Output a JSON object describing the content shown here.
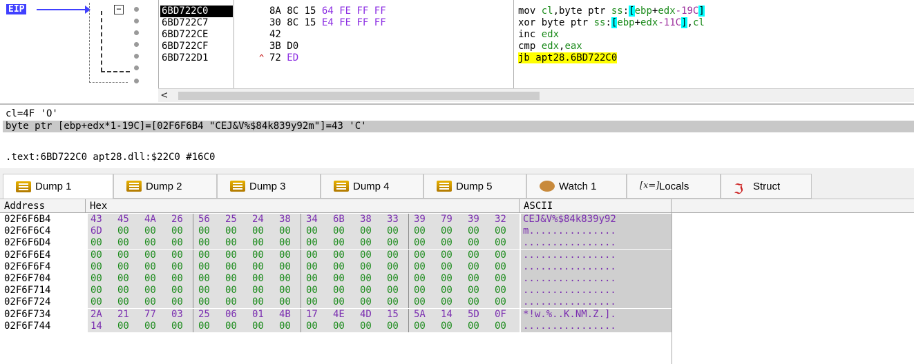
{
  "disassembly": {
    "eip_label": "EIP",
    "collapse_glyph": "−",
    "scroll_left_glyph": "<",
    "rows": [
      {
        "address": "6BD722C0",
        "marker": "",
        "bytes": [
          {
            "t": "8A",
            "c": "a"
          },
          {
            "t": "8C",
            "c": "a"
          },
          {
            "t": "15",
            "c": "a"
          },
          {
            "t": "64",
            "c": "b"
          },
          {
            "t": "FE",
            "c": "b"
          },
          {
            "t": "FF",
            "c": "b"
          },
          {
            "t": "FF",
            "c": "b"
          }
        ],
        "selected": true,
        "instr": [
          {
            "t": "mov ",
            "c": "kw"
          },
          {
            "t": "cl",
            "c": "reg"
          },
          {
            "t": ",byte ptr ",
            "c": "kw"
          },
          {
            "t": "ss",
            "c": "reg"
          },
          {
            "t": ":",
            "c": "kw"
          },
          {
            "t": "[",
            "c": "bracket"
          },
          {
            "t": "ebp",
            "c": "reg"
          },
          {
            "t": "+",
            "c": "kw"
          },
          {
            "t": "edx",
            "c": "reg"
          },
          {
            "t": "-19C",
            "c": "num"
          },
          {
            "t": "]",
            "c": "bracket"
          }
        ]
      },
      {
        "address": "6BD722C7",
        "marker": "",
        "bytes": [
          {
            "t": "30",
            "c": "a"
          },
          {
            "t": "8C",
            "c": "a"
          },
          {
            "t": "15",
            "c": "a"
          },
          {
            "t": "E4",
            "c": "b"
          },
          {
            "t": "FE",
            "c": "b"
          },
          {
            "t": "FF",
            "c": "b"
          },
          {
            "t": "FF",
            "c": "b"
          }
        ],
        "selected": false,
        "instr": [
          {
            "t": "xor ",
            "c": "kw"
          },
          {
            "t": "byte ptr ",
            "c": "kw"
          },
          {
            "t": "ss",
            "c": "reg"
          },
          {
            "t": ":",
            "c": "kw"
          },
          {
            "t": "[",
            "c": "bracket"
          },
          {
            "t": "ebp",
            "c": "reg"
          },
          {
            "t": "+",
            "c": "kw"
          },
          {
            "t": "edx",
            "c": "reg"
          },
          {
            "t": "-11C",
            "c": "num"
          },
          {
            "t": "]",
            "c": "bracket"
          },
          {
            "t": ",",
            "c": "kw"
          },
          {
            "t": "cl",
            "c": "reg"
          }
        ]
      },
      {
        "address": "6BD722CE",
        "marker": "",
        "bytes": [
          {
            "t": "42",
            "c": "a"
          }
        ],
        "selected": false,
        "instr": [
          {
            "t": "inc ",
            "c": "kw"
          },
          {
            "t": "edx",
            "c": "reg"
          }
        ]
      },
      {
        "address": "6BD722CF",
        "marker": "",
        "bytes": [
          {
            "t": "3B",
            "c": "a"
          },
          {
            "t": "D0",
            "c": "a"
          }
        ],
        "selected": false,
        "instr": [
          {
            "t": "cmp ",
            "c": "kw"
          },
          {
            "t": "edx",
            "c": "reg"
          },
          {
            "t": ",",
            "c": "kw"
          },
          {
            "t": "eax",
            "c": "reg"
          }
        ]
      },
      {
        "address": "6BD722D1",
        "marker": "^",
        "bytes": [
          {
            "t": "72",
            "c": "a"
          },
          {
            "t": "ED",
            "c": "b"
          }
        ],
        "selected": false,
        "instr": [
          {
            "t": "jb",
            "c": "hl"
          },
          {
            "t": " apt28.6BD722C0",
            "c": "hl"
          }
        ]
      }
    ]
  },
  "info": {
    "line1": "cl=4F 'O'",
    "line2": "byte ptr [ebp+edx*1-19C]=[02F6F6B4 \"CEJ&V%$84k839y92m\"]=43 'C'",
    "line3": ".text:6BD722C0 apt28.dll:$22C0 #16C0"
  },
  "tabs": [
    {
      "label": "Dump 1",
      "icon": "dump-icon",
      "active": true
    },
    {
      "label": "Dump 2",
      "icon": "dump-icon",
      "active": false
    },
    {
      "label": "Dump 3",
      "icon": "dump-icon",
      "active": false
    },
    {
      "label": "Dump 4",
      "icon": "dump-icon",
      "active": false
    },
    {
      "label": "Dump 5",
      "icon": "dump-icon",
      "active": false
    },
    {
      "label": "Watch 1",
      "icon": "watch-icon",
      "active": false
    },
    {
      "label": "Locals",
      "icon": "locals-icon",
      "icon_text": "[x=]",
      "active": false
    },
    {
      "label": "Struct",
      "icon": "struct-icon",
      "icon_text": "ℑ",
      "active": false
    }
  ],
  "dump": {
    "headers": {
      "address": "Address",
      "hex": "Hex",
      "ascii": "ASCII"
    },
    "rows": [
      {
        "address": "02F6F6B4",
        "bytes": [
          "43",
          "45",
          "4A",
          "26",
          "56",
          "25",
          "24",
          "38",
          "34",
          "6B",
          "38",
          "33",
          "39",
          "79",
          "39",
          "32"
        ],
        "ascii": "CEJ&V%$84k839y92"
      },
      {
        "address": "02F6F6C4",
        "bytes": [
          "6D",
          "00",
          "00",
          "00",
          "00",
          "00",
          "00",
          "00",
          "00",
          "00",
          "00",
          "00",
          "00",
          "00",
          "00",
          "00"
        ],
        "ascii": "m..............."
      },
      {
        "address": "02F6F6D4",
        "bytes": [
          "00",
          "00",
          "00",
          "00",
          "00",
          "00",
          "00",
          "00",
          "00",
          "00",
          "00",
          "00",
          "00",
          "00",
          "00",
          "00"
        ],
        "ascii": "................"
      },
      {
        "address": "02F6F6E4",
        "bytes": [
          "00",
          "00",
          "00",
          "00",
          "00",
          "00",
          "00",
          "00",
          "00",
          "00",
          "00",
          "00",
          "00",
          "00",
          "00",
          "00"
        ],
        "ascii": "................"
      },
      {
        "address": "02F6F6F4",
        "bytes": [
          "00",
          "00",
          "00",
          "00",
          "00",
          "00",
          "00",
          "00",
          "00",
          "00",
          "00",
          "00",
          "00",
          "00",
          "00",
          "00"
        ],
        "ascii": "................"
      },
      {
        "address": "02F6F704",
        "bytes": [
          "00",
          "00",
          "00",
          "00",
          "00",
          "00",
          "00",
          "00",
          "00",
          "00",
          "00",
          "00",
          "00",
          "00",
          "00",
          "00"
        ],
        "ascii": "................"
      },
      {
        "address": "02F6F714",
        "bytes": [
          "00",
          "00",
          "00",
          "00",
          "00",
          "00",
          "00",
          "00",
          "00",
          "00",
          "00",
          "00",
          "00",
          "00",
          "00",
          "00"
        ],
        "ascii": "................"
      },
      {
        "address": "02F6F724",
        "bytes": [
          "00",
          "00",
          "00",
          "00",
          "00",
          "00",
          "00",
          "00",
          "00",
          "00",
          "00",
          "00",
          "00",
          "00",
          "00",
          "00"
        ],
        "ascii": "................"
      },
      {
        "address": "02F6F734",
        "bytes": [
          "2A",
          "21",
          "77",
          "03",
          "25",
          "06",
          "01",
          "4B",
          "17",
          "4E",
          "4D",
          "15",
          "5A",
          "14",
          "5D",
          "0F"
        ],
        "ascii": "*!w.%..K.NM.Z.]."
      },
      {
        "address": "02F6F744",
        "bytes": [
          "14",
          "00",
          "00",
          "00",
          "00",
          "00",
          "00",
          "00",
          "00",
          "00",
          "00",
          "00",
          "00",
          "00",
          "00",
          "00"
        ],
        "ascii": "................"
      }
    ]
  },
  "colors": {
    "eip": "#4040ff",
    "register": "#1a8a1a",
    "immediate": "#9b2b9b",
    "bracket_hl": "#00ffff",
    "jump_hl": "#ffff00"
  }
}
